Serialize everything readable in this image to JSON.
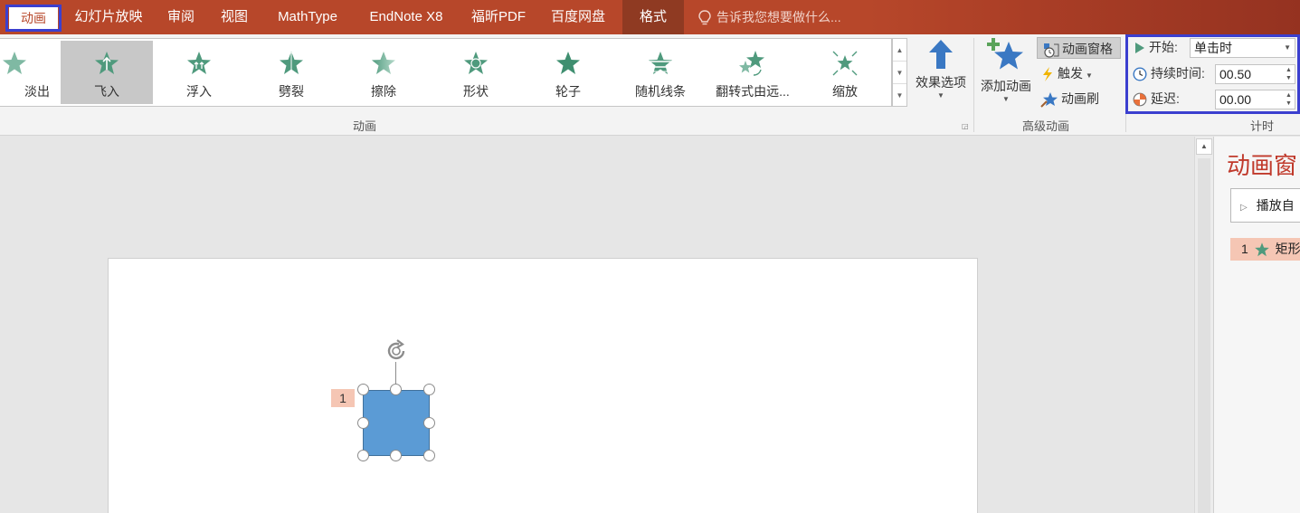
{
  "tabs": {
    "animation": "动画",
    "slideshow": "幻灯片放映",
    "review": "审阅",
    "view": "视图",
    "mathtype": "MathType",
    "endnote": "EndNote X8",
    "foxit": "福昕PDF",
    "baidu": "百度网盘",
    "format": "格式"
  },
  "tell_me": "告诉我您想要做什么...",
  "gallery": {
    "items": [
      {
        "label": "淡出",
        "icon": "fade-star-icon"
      },
      {
        "label": "飞入",
        "icon": "fly-in-star-icon",
        "selected": true
      },
      {
        "label": "浮入",
        "icon": "float-in-star-icon"
      },
      {
        "label": "劈裂",
        "icon": "split-star-icon"
      },
      {
        "label": "擦除",
        "icon": "wipe-star-icon"
      },
      {
        "label": "形状",
        "icon": "shape-star-icon"
      },
      {
        "label": "轮子",
        "icon": "wheel-star-icon"
      },
      {
        "label": "随机线条",
        "icon": "random-bars-star-icon"
      },
      {
        "label": "翻转式由远...",
        "icon": "grow-turn-star-icon"
      },
      {
        "label": "缩放",
        "icon": "zoom-star-icon"
      }
    ]
  },
  "effect_options": "效果选项",
  "group_animation": "动画",
  "advanced": {
    "add_animation": "添加动画",
    "animation_pane": "动画窗格",
    "trigger": "触发",
    "animation_painter": "动画刷",
    "group_label": "高级动画"
  },
  "timing": {
    "start_label": "开始:",
    "start_value": "单击时",
    "duration_label": "持续时间:",
    "duration_value": "00.50",
    "delay_label": "延迟:",
    "delay_value": "00.00",
    "group_label": "计时"
  },
  "pane": {
    "title": "动画窗",
    "play_label": "播放自",
    "item_number": "1",
    "item_label": "矩形"
  },
  "slide": {
    "tag_number": "1"
  },
  "colors": {
    "accent": "#b7472a",
    "star_green": "#4f9a7d",
    "shape_fill": "#5b9bd5",
    "highlight_box": "#3b3fcf",
    "tag_bg": "#f5c6b4"
  }
}
